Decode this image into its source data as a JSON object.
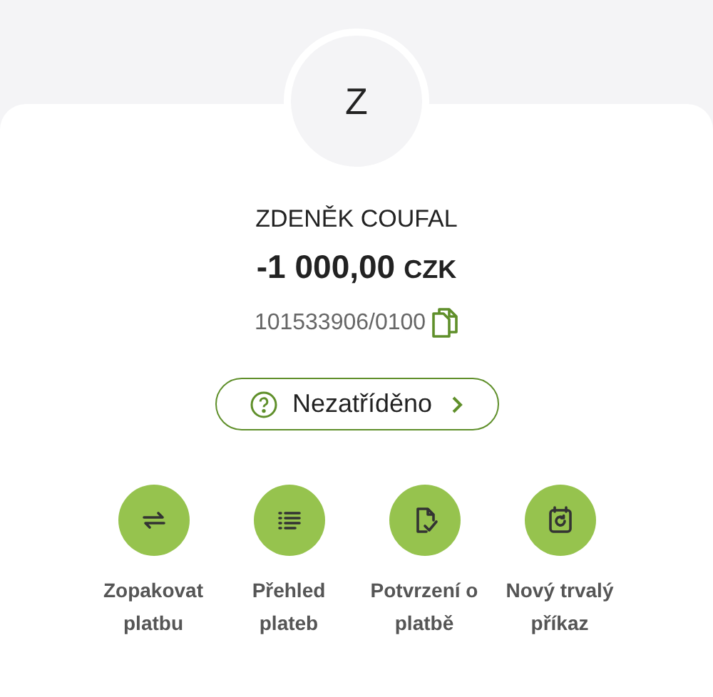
{
  "avatar": {
    "initial": "Z"
  },
  "payment": {
    "name": "ZDENĚK COUFAL",
    "amount": "-1 000,00",
    "currency": "CZK",
    "account": "101533906/0100"
  },
  "category": {
    "label": "Nezatříděno"
  },
  "actions": [
    {
      "kind": "repeat",
      "label": "Zopakovat platbu"
    },
    {
      "kind": "list",
      "label": "Přehled plateb"
    },
    {
      "kind": "confirm",
      "label": "Potvrzení o platbě"
    },
    {
      "kind": "standing",
      "label": "Nový trvalý příkaz"
    }
  ]
}
